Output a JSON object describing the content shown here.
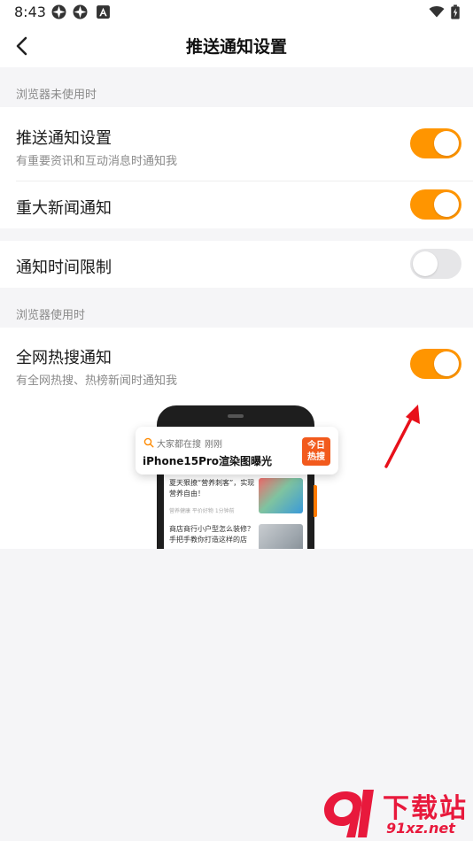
{
  "status_bar": {
    "time": "8:43"
  },
  "header": {
    "title": "推送通知设置"
  },
  "sections": {
    "idle": {
      "label": "浏览器未使用时"
    },
    "active": {
      "label": "浏览器使用时"
    }
  },
  "settings": {
    "push": {
      "title": "推送通知设置",
      "subtitle": "有重要资讯和互动消息时通知我",
      "enabled": true
    },
    "major_news": {
      "title": "重大新闻通知",
      "enabled": true
    },
    "time_limit": {
      "title": "通知时间限制",
      "enabled": false
    },
    "hot_search": {
      "title": "全网热搜通知",
      "subtitle": "有全网热搜、热榜新闻时通知我",
      "enabled": true
    }
  },
  "preview": {
    "notification": {
      "source": "大家都在搜",
      "time": "刚刚",
      "title": "iPhone15Pro渲染图曝光",
      "badge_line1": "今日",
      "badge_line2": "热搜"
    },
    "news": [
      {
        "title": "夏天狠撩“营养刺客”，实现营养自由！",
        "meta": "营养健康  平价好物  1分钟前"
      },
      {
        "title": "商店商行小户型怎么装修？手把手教你打造这样的店"
      }
    ]
  },
  "colors": {
    "accent": "#ff9500",
    "toggle_off": "#e6e6e8",
    "badge": "#f25a1d",
    "watermark": "#e8193c",
    "arrow": "#e8101a"
  },
  "watermark": {
    "name": "下载站",
    "url": "91xz.net"
  }
}
